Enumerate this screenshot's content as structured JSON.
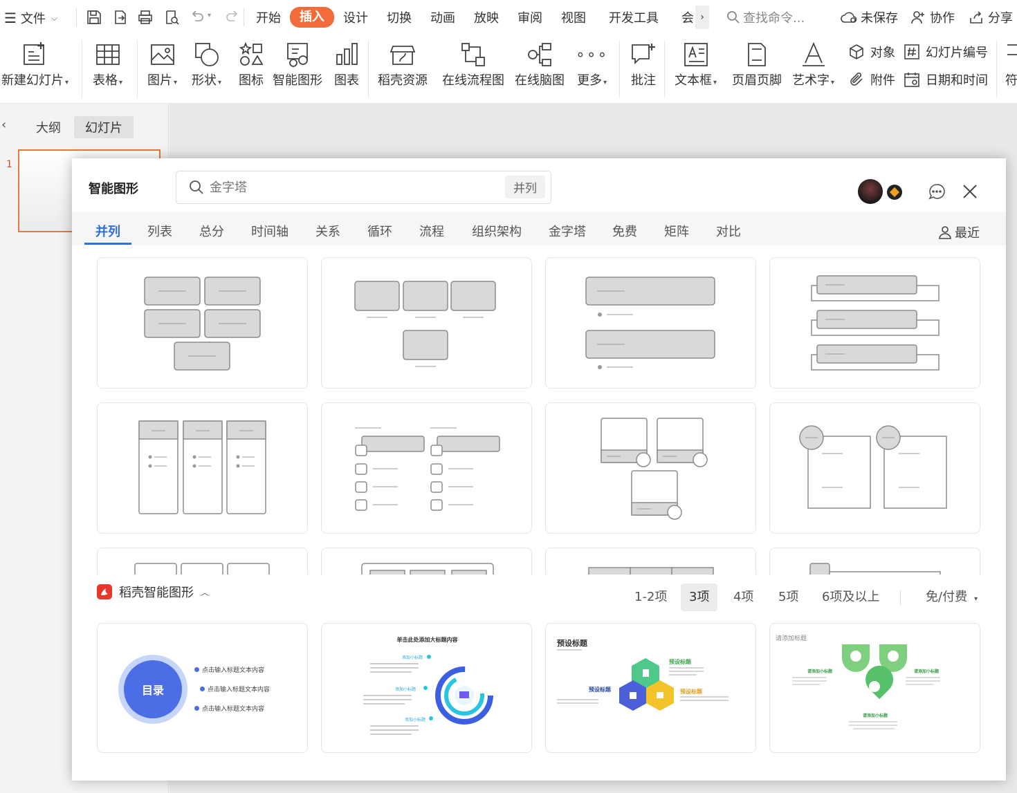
{
  "menubar": {
    "file": "文件",
    "tabs": [
      "开始",
      "插入",
      "设计",
      "切换",
      "动画",
      "放映",
      "审阅",
      "视图",
      "开发工具",
      "会"
    ],
    "active_tab": "插入",
    "search_placeholder": "查找命令...",
    "unsaved": "未保存",
    "collab": "协作",
    "share": "分享"
  },
  "ribbon": {
    "new_slide": "新建幻灯片",
    "table": "表格",
    "picture": "图片",
    "shape": "形状",
    "icon": "图标",
    "smartart": "智能图形",
    "chart": "图表",
    "docer": "稻壳资源",
    "flowchart": "在线流程图",
    "mindmap": "在线脑图",
    "more": "更多",
    "comment": "批注",
    "textbox": "文本框",
    "header_footer": "页眉页脚",
    "wordart": "艺术字",
    "object": "对象",
    "slide_number": "幻灯片编号",
    "attachment": "附件",
    "datetime": "日期和时间",
    "symbol": "符"
  },
  "leftpane": {
    "outline_tab": "大纲",
    "slides_tab": "幻灯片",
    "slide_number": "1"
  },
  "dialog": {
    "title": "智能图形",
    "search_placeholder": "金字塔",
    "search_tag": "并列",
    "categories": [
      "并列",
      "列表",
      "总分",
      "时间轴",
      "关系",
      "循环",
      "流程",
      "组织架构",
      "金字塔",
      "免费",
      "矩阵",
      "对比"
    ],
    "active_category": "并列",
    "recent": "最近",
    "section_title": "稻壳智能图形",
    "filters": [
      "1-2项",
      "3项",
      "4项",
      "5项",
      "6项及以上"
    ],
    "active_filter": "3项",
    "price_filter": "免/付费",
    "templates": [
      {
        "center": "目录",
        "items": [
          "点击输入标题文本内容",
          "点击输入标题文本内容",
          "点击输入标题文本内容"
        ]
      },
      {
        "title": "单击此处添加大标题内容",
        "labels": [
          "添加小标题",
          "添加小标题",
          "添加小标题"
        ]
      },
      {
        "title": "预设标题",
        "labels": [
          "预设标题",
          "预设标题",
          "预设标题"
        ]
      },
      {
        "title": "请添加标题",
        "labels": [
          "请添加小标题",
          "请添加小标题",
          "请添加小标题"
        ]
      }
    ]
  },
  "colors": {
    "accent": "#f26b3a",
    "tab_active": "#2f6ce5"
  }
}
